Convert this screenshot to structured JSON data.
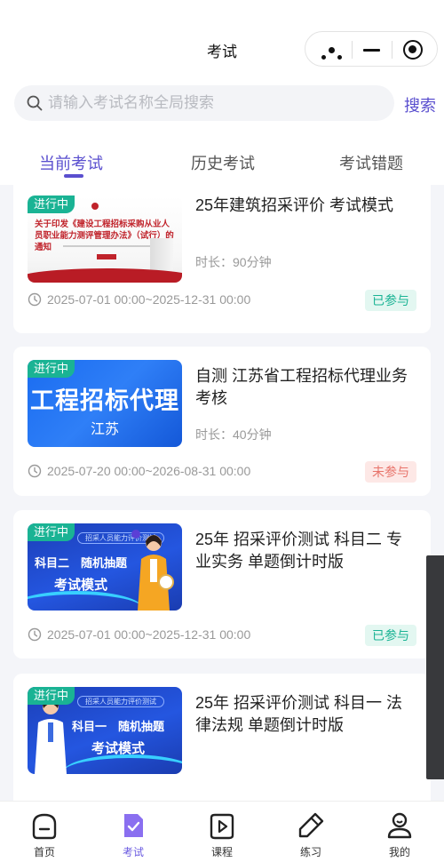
{
  "navbar": {
    "title": "考试"
  },
  "search": {
    "placeholder": "请输入考试名称全局搜索",
    "button": "搜索"
  },
  "tabs": [
    {
      "label": "当前考试",
      "active": true
    },
    {
      "label": "历史考试",
      "active": false
    },
    {
      "label": "考试错题",
      "active": false
    }
  ],
  "exams": [
    {
      "badge": "进行中",
      "title": "25年建筑招采评价 考试模式",
      "duration": "时长：90分钟",
      "time": "2025-07-01 00:00~2025-12-31 00:00",
      "status": "已参与",
      "thumb_text": "关于印发《建设工程招标采购从业人员职业能力测评管理办法》（试行）的通知"
    },
    {
      "badge": "进行中",
      "title": "自测 江苏省工程招标代理业务考核",
      "duration": "时长：40分钟",
      "time": "2025-07-20 00:00~2026-08-31 00:00",
      "status": "未参与",
      "thumb_big": "工程招标代理",
      "thumb_small": "江苏"
    },
    {
      "badge": "进行中",
      "title": "25年 招采评价测试 科目二 专业实务 单题倒计时版",
      "time": "2025-07-01 00:00~2025-12-31 00:00",
      "status": "已参与",
      "thumb_pill": "招采人员能力评价测试",
      "thumb_line1": "科目二　随机抽题",
      "thumb_line2": "考试模式"
    },
    {
      "badge": "进行中",
      "title": "25年 招采评价测试 科目一 法律法规 单题倒计时版",
      "thumb_pill": "招采人员能力评价测试",
      "thumb_line1": "科目一　随机抽题",
      "thumb_line2": "考试模式"
    }
  ],
  "tabbar": [
    {
      "label": "首页",
      "icon": "home-icon",
      "active": false
    },
    {
      "label": "考试",
      "icon": "exam-icon",
      "active": true
    },
    {
      "label": "课程",
      "icon": "course-icon",
      "active": false
    },
    {
      "label": "练习",
      "icon": "practice-icon",
      "active": false
    },
    {
      "label": "我的",
      "icon": "profile-icon",
      "active": false
    }
  ],
  "colors": {
    "accent": "#5a4fcf",
    "live": "#1ab394",
    "joined": "#1ab394",
    "not_joined": "#e8736a"
  }
}
